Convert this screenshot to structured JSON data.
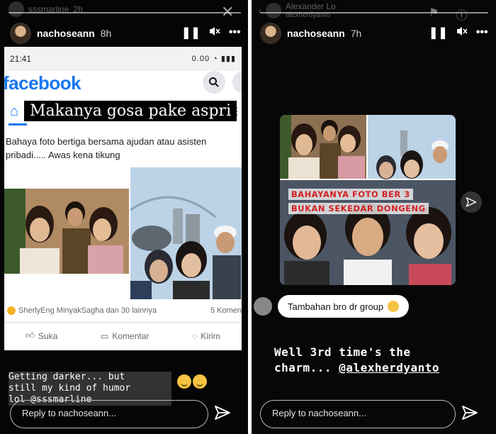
{
  "left_story": {
    "ghost_user": "sssmarline",
    "ghost_time": "2h",
    "username": "nachoseann",
    "time": "8h",
    "fb_screenshot": {
      "status_time": "21:41",
      "status_right": "0.00",
      "logo": "facebook",
      "overlay_caption": "Makanya gosa pake aspri",
      "post_text": "Bahaya foto bertiga bersama ajudan atau asisten pribadi..... Awas kena tikung",
      "reactions_text": "SherlyEng MinyakSagha dan 30 lainnya",
      "comments_count": "5 Komen",
      "actions": [
        "Suka",
        "Komentar",
        "Kirim"
      ]
    },
    "caption_lines": [
      "Getting darker... but",
      "still my kind of humor",
      "lol @sssmarline"
    ],
    "reply_placeholder": "Reply to nachoseann..."
  },
  "right_story": {
    "ghost_user": "Alexander Lo",
    "ghost_sub": "alexherdyanto",
    "username": "nachoseann",
    "time": "7h",
    "collage_text_1": "BAHAYANYA FOTO BER 3",
    "collage_text_2": "BUKAN SEKEDAR DONGENG",
    "reply_snippet": "Tambahan bro dr group",
    "caption_line1": "Well 3rd time's the",
    "caption_line2_prefix": "charm... ",
    "caption_mention": "@alexherdyanto",
    "reply_placeholder": "Reply to nachoseann..."
  },
  "colors": {
    "facebook_blue": "#1877f2",
    "collage_red": "#d32020",
    "story_bg": "#050505"
  }
}
